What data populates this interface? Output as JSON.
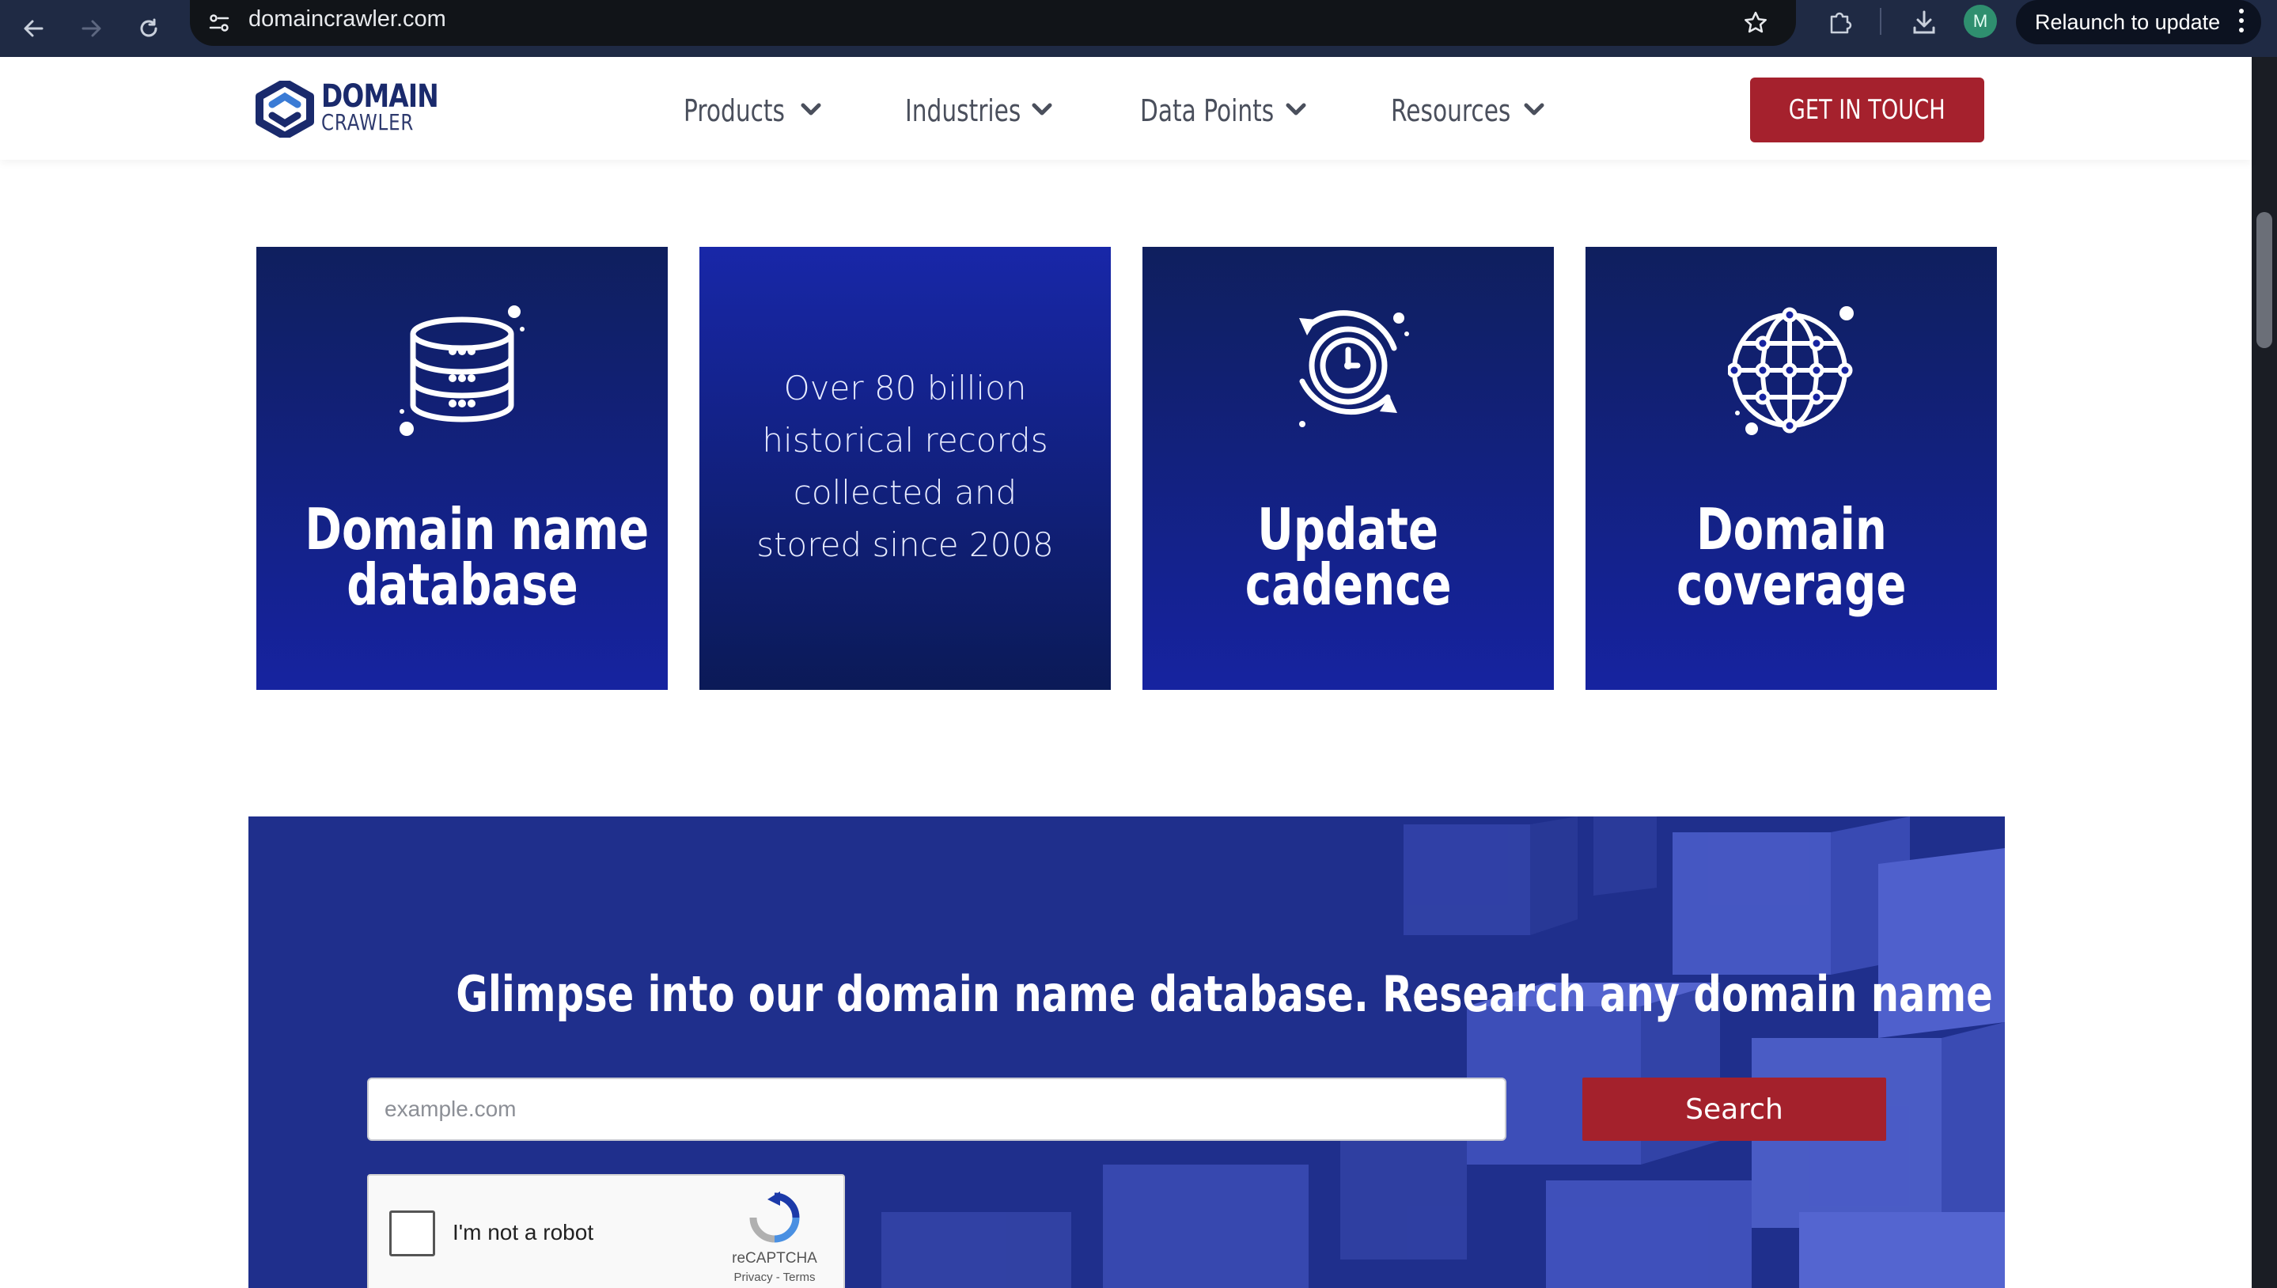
{
  "browser": {
    "url": "domaincrawler.com",
    "relaunch_label": "Relaunch to update",
    "profile_initial": "M",
    "icons": [
      "back-icon",
      "forward-icon",
      "reload-icon",
      "site-info-icon",
      "bookmark-star-icon",
      "extensions-icon",
      "download-icon",
      "menu-dots-icon"
    ]
  },
  "header": {
    "logo_line1": "DOMAIN",
    "logo_line2": "CRAWLER",
    "nav": [
      {
        "label": "Products"
      },
      {
        "label": "Industries"
      },
      {
        "label": "Data Points"
      },
      {
        "label": "Resources"
      }
    ],
    "cta_label": "GET IN TOUCH"
  },
  "cards": [
    {
      "title_line1": "Domain name",
      "title_line2": "database",
      "icon": "database-icon"
    },
    {
      "stat_lines": [
        "Over 80 billion",
        "historical records",
        "collected and",
        "stored since 2008"
      ]
    },
    {
      "title_line1": "Update",
      "title_line2": "cadence",
      "icon": "clock-refresh-icon"
    },
    {
      "title_line1": "Domain",
      "title_line2": "coverage",
      "icon": "globe-network-icon"
    }
  ],
  "search": {
    "heading": "Glimpse into our domain name database. Research any domain name now!",
    "placeholder": "example.com",
    "value": "",
    "button_label": "Search"
  },
  "recaptcha": {
    "label": "I'm not a robot",
    "brand": "reCAPTCHA",
    "links": "Privacy - Terms"
  },
  "colors": {
    "chrome_bg": "#1f2a44",
    "brand_navy": "#1a2a6c",
    "card_blue": "#1623a0",
    "accent_red": "#a5212d",
    "banner_blue": "#1f2f8c"
  }
}
